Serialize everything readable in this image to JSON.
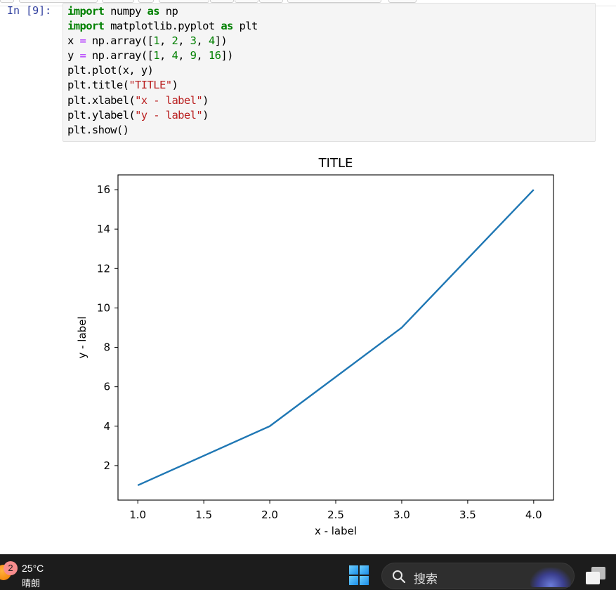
{
  "cell": {
    "prompt": "In  [9]:",
    "code_lines": [
      [
        {
          "t": "kw",
          "v": "import"
        },
        {
          "t": "",
          "v": " numpy "
        },
        {
          "t": "kw",
          "v": "as"
        },
        {
          "t": "",
          "v": " np"
        }
      ],
      [
        {
          "t": "kw",
          "v": "import"
        },
        {
          "t": "",
          "v": " matplotlib.pyplot "
        },
        {
          "t": "kw",
          "v": "as"
        },
        {
          "t": "",
          "v": " plt"
        }
      ],
      [
        {
          "t": "",
          "v": "x "
        },
        {
          "t": "op",
          "v": "="
        },
        {
          "t": "",
          "v": " np.array(["
        },
        {
          "t": "num",
          "v": "1"
        },
        {
          "t": "",
          "v": ", "
        },
        {
          "t": "num",
          "v": "2"
        },
        {
          "t": "",
          "v": ", "
        },
        {
          "t": "num",
          "v": "3"
        },
        {
          "t": "",
          "v": ", "
        },
        {
          "t": "num",
          "v": "4"
        },
        {
          "t": "",
          "v": "])"
        }
      ],
      [
        {
          "t": "",
          "v": "y "
        },
        {
          "t": "op",
          "v": "="
        },
        {
          "t": "",
          "v": " np.array(["
        },
        {
          "t": "num",
          "v": "1"
        },
        {
          "t": "",
          "v": ", "
        },
        {
          "t": "num",
          "v": "4"
        },
        {
          "t": "",
          "v": ", "
        },
        {
          "t": "num",
          "v": "9"
        },
        {
          "t": "",
          "v": ", "
        },
        {
          "t": "num",
          "v": "16"
        },
        {
          "t": "",
          "v": "])"
        }
      ],
      [
        {
          "t": "",
          "v": "plt.plot(x, y)"
        }
      ],
      [
        {
          "t": "",
          "v": "plt.title("
        },
        {
          "t": "str",
          "v": "\"TITLE\""
        },
        {
          "t": "",
          "v": ")"
        }
      ],
      [
        {
          "t": "",
          "v": "plt.xlabel("
        },
        {
          "t": "str",
          "v": "\"x - label\""
        },
        {
          "t": "",
          "v": ")"
        }
      ],
      [
        {
          "t": "",
          "v": "plt.ylabel("
        },
        {
          "t": "str",
          "v": "\"y - label\""
        },
        {
          "t": "",
          "v": ")"
        }
      ],
      [
        {
          "t": "",
          "v": "plt.show()"
        }
      ]
    ]
  },
  "chart_data": {
    "type": "line",
    "title": "TITLE",
    "xlabel": "x - label",
    "ylabel": "y - label",
    "series": [
      {
        "x": [
          1,
          2,
          3,
          4
        ],
        "y": [
          1,
          4,
          9,
          16
        ],
        "color": "#1f77b4"
      }
    ],
    "xlim": [
      0.85,
      4.15
    ],
    "ylim": [
      0.25,
      16.75
    ],
    "xticks": [
      1.0,
      1.5,
      2.0,
      2.5,
      3.0,
      3.5,
      4.0
    ],
    "xtick_labels": [
      "1.0",
      "1.5",
      "2.0",
      "2.5",
      "3.0",
      "3.5",
      "4.0"
    ],
    "yticks": [
      2,
      4,
      6,
      8,
      10,
      12,
      14,
      16
    ],
    "ytick_labels": [
      "2",
      "4",
      "6",
      "8",
      "10",
      "12",
      "14",
      "16"
    ],
    "grid": false
  },
  "taskbar": {
    "notification_count": "2",
    "temperature": "25°C",
    "condition": "晴朗",
    "search_placeholder": "搜索"
  }
}
